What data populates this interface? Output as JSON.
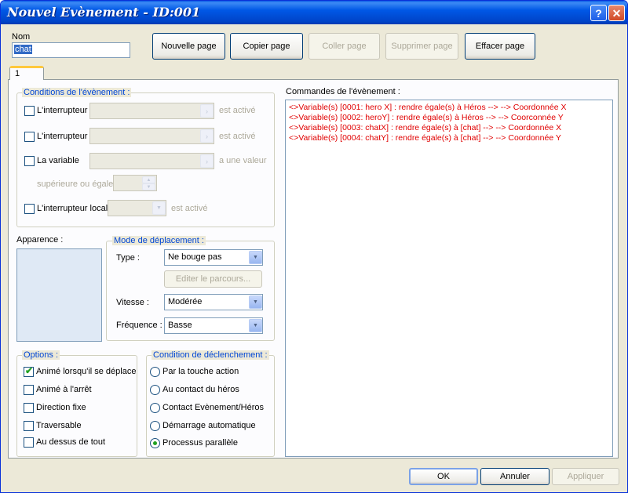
{
  "window": {
    "title": "Nouvel Evènement - ID:001"
  },
  "header": {
    "name_label": "Nom",
    "name_value": "chat",
    "buttons": {
      "new_page": "Nouvelle page",
      "copy_page": "Copier page",
      "paste_page": "Coller page",
      "delete_page": "Supprimer page",
      "clear_page": "Effacer page"
    }
  },
  "tabs": [
    {
      "label": "1"
    }
  ],
  "conditions": {
    "legend": "Conditions de l'évènement :",
    "switch1": {
      "label": "L'interrupteur",
      "suffix": "est activé"
    },
    "switch2": {
      "label": "L'interrupteur",
      "suffix": "est activé"
    },
    "variable": {
      "label": "La variable",
      "suffix": "a une valeur",
      "comparison": "supérieure ou égale"
    },
    "local_switch": {
      "label": "L'interrupteur local",
      "suffix": "est activé"
    }
  },
  "appearance": {
    "label": "Apparence :"
  },
  "movement": {
    "legend": "Mode de déplacement :",
    "type_label": "Type :",
    "type_value": "Ne bouge pas",
    "edit_route": "Editer le parcours...",
    "speed_label": "Vitesse :",
    "speed_value": "Modérée",
    "frequency_label": "Fréquence :",
    "frequency_value": "Basse"
  },
  "options": {
    "legend": "Options :",
    "items": [
      {
        "label": "Animé lorsqu'il se déplace",
        "checked": true
      },
      {
        "label": "Animé à l'arrêt",
        "checked": false
      },
      {
        "label": "Direction fixe",
        "checked": false
      },
      {
        "label": "Traversable",
        "checked": false
      },
      {
        "label": "Au dessus de tout",
        "checked": false
      }
    ]
  },
  "trigger": {
    "legend": "Condition de déclenchement :",
    "items": [
      {
        "label": "Par la touche action",
        "selected": false
      },
      {
        "label": "Au contact du héros",
        "selected": false
      },
      {
        "label": "Contact Evènement/Héros",
        "selected": false
      },
      {
        "label": "Démarrage automatique",
        "selected": false
      },
      {
        "label": "Processus parallèle",
        "selected": true
      }
    ]
  },
  "commands": {
    "label": "Commandes de l'évènement :",
    "lines": [
      "<>Variable(s) [0001: hero X] : rendre égale(s) à Héros --> --> Coordonnée X",
      "<>Variable(s) [0002: heroY] : rendre égale(s) à Héros --> --> Coorconnée Y",
      "<>Variable(s) [0003: chatX] : rendre égale(s) à [chat] --> --> Coordonnée X",
      "<>Variable(s) [0004: chatY] : rendre égale(s) à [chat] --> --> Coordonnée Y"
    ]
  },
  "footer": {
    "ok": "OK",
    "cancel": "Annuler",
    "apply": "Appliquer"
  },
  "icons": {
    "help": "?",
    "close": "✕",
    "arrow_right": "›",
    "spin_up": "▲",
    "spin_down": "▼",
    "chevron_down": "▼",
    "checkmark": "✔"
  },
  "colors": {
    "title_bar": "#0054e3",
    "legend_text": "#0046d5",
    "command_text": "#e00000",
    "check_mark": "#21a121"
  }
}
